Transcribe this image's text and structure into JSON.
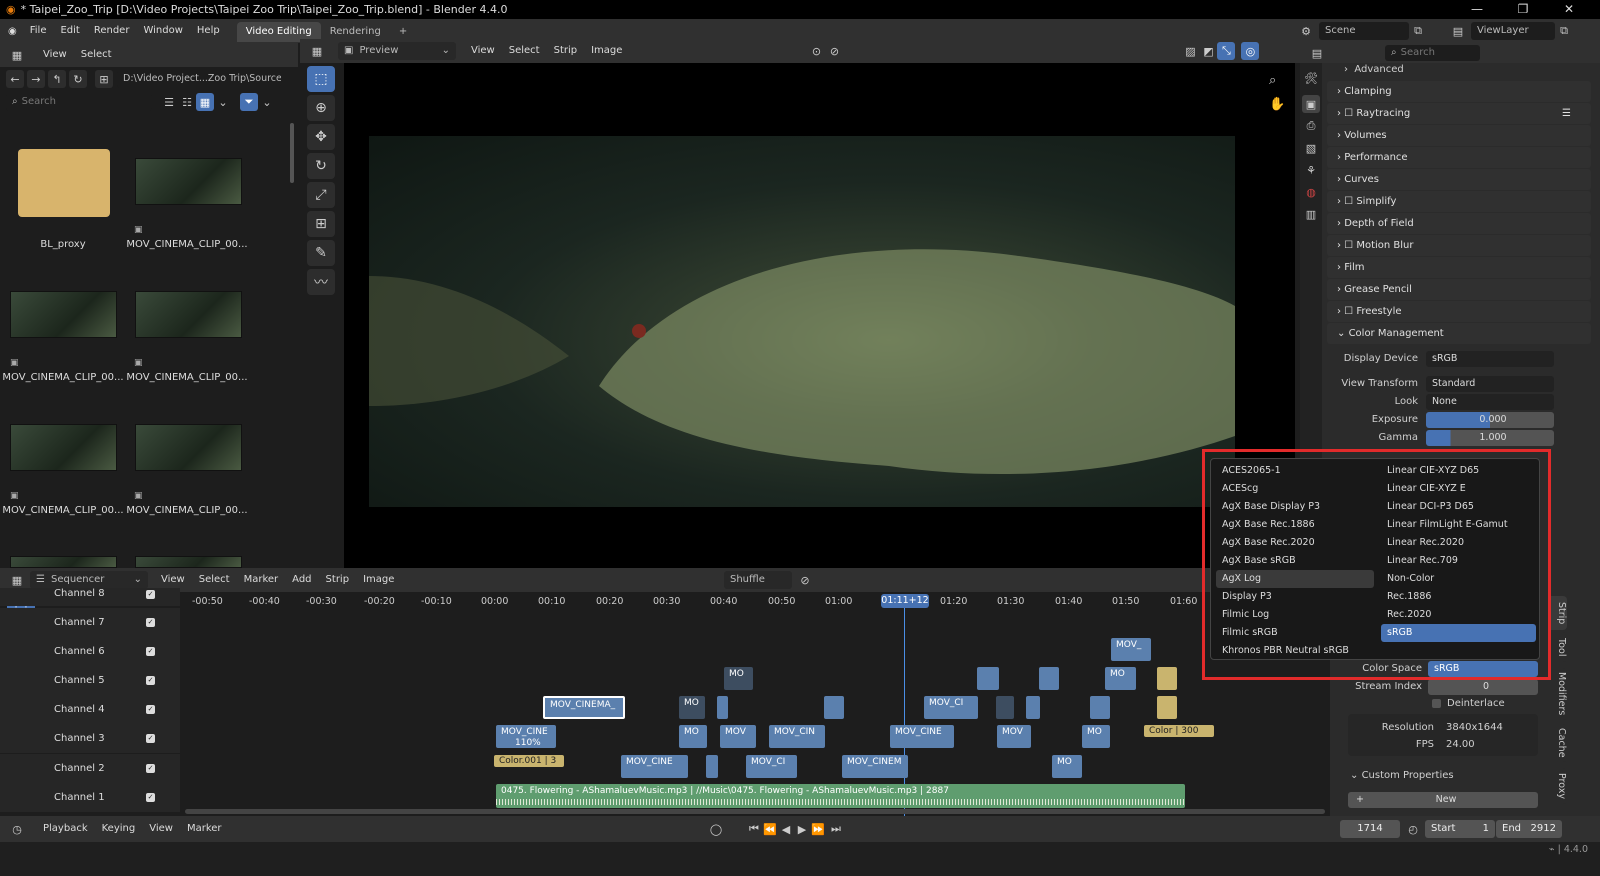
{
  "titlebar": {
    "title": "* Taipei_Zoo_Trip [D:\\Video Projects\\Taipei Zoo Trip\\Taipei_Zoo_Trip.blend] - Blender 4.4.0",
    "minimize": "—",
    "maximize": "❐",
    "close": "✕"
  },
  "topbar": {
    "menus": [
      "File",
      "Edit",
      "Render",
      "Window",
      "Help"
    ],
    "workspaces": [
      "Video Editing",
      "Rendering"
    ],
    "add_workspace": "+",
    "scene": "Scene",
    "viewlayer": "ViewLayer"
  },
  "filebrowser": {
    "menus": [
      "View",
      "Select"
    ],
    "path": "D:\\Video Project...Zoo Trip\\Source\\",
    "search_placeholder": "Search",
    "items": [
      "BL_proxy",
      "MOV_CINEMA_CLIP_00...",
      "MOV_CINEMA_CLIP_00...",
      "MOV_CINEMA_CLIP_00...",
      "MOV_CINEMA_CLIP_00...",
      "MOV_CINEMA_CLIP_00..."
    ]
  },
  "preview_header": {
    "mode": "Preview",
    "menus": [
      "View",
      "Select",
      "Strip",
      "Image"
    ]
  },
  "properties": {
    "search_placeholder": "Search",
    "panels": [
      "Advanced",
      "Clamping",
      "Raytracing",
      "Volumes",
      "Performance",
      "Curves",
      "Simplify",
      "Depth of Field",
      "Motion Blur",
      "Film",
      "Grease Pencil",
      "Freestyle",
      "Color Management"
    ],
    "display_device_label": "Display Device",
    "display_device": "sRGB",
    "view_transform_label": "View Transform",
    "view_transform": "Standard",
    "look_label": "Look",
    "look": "None",
    "exposure_label": "Exposure",
    "exposure": "0.000",
    "gamma_label": "Gamma",
    "gamma": "1.000",
    "color_space_label": "Color Space",
    "color_space": "sRGB",
    "stream_index_label": "Stream Index",
    "stream_index": "0",
    "deinterlace_label": "Deinterlace",
    "resolution_label": "Resolution",
    "resolution": "3840x1644",
    "fps_label": "FPS",
    "fps": "24.00",
    "custom_props": "Custom Properties",
    "new_button": "New",
    "side_tabs": [
      "Strip",
      "Tool",
      "Modifiers",
      "Cache",
      "Proxy"
    ]
  },
  "colorspace_menu": {
    "left": [
      "ACES2065-1",
      "ACEScg",
      "AgX Base Display P3",
      "AgX Base Rec.1886",
      "AgX Base Rec.2020",
      "AgX Base sRGB",
      "AgX Log",
      "Display P3",
      "Filmic Log",
      "Filmic sRGB",
      "Khronos PBR Neutral sRGB"
    ],
    "right": [
      "Linear CIE-XYZ D65",
      "Linear CIE-XYZ E",
      "Linear DCI-P3 D65",
      "Linear FilmLight E-Gamut",
      "Linear Rec.2020",
      "Linear Rec.709",
      "Non-Color",
      "Rec.1886",
      "Rec.2020",
      "sRGB"
    ],
    "hovered": "AgX Log",
    "selected": "sRGB"
  },
  "sequencer": {
    "mode": "Sequencer",
    "menus": [
      "View",
      "Select",
      "Marker",
      "Add",
      "Strip",
      "Image"
    ],
    "overlap": "Shuffle",
    "channels": [
      "Channel 8",
      "Channel 7",
      "Channel 6",
      "Channel 5",
      "Channel 4",
      "Channel 3",
      "Channel 2",
      "Channel 1"
    ],
    "ticks": [
      "-00:50",
      "-00:40",
      "-00:30",
      "-00:20",
      "-00:10",
      "00:00",
      "00:10",
      "00:20",
      "00:30",
      "00:40",
      "00:50",
      "01:00",
      "01:20",
      "01:30",
      "01:40",
      "01:50",
      "01:60"
    ],
    "playhead": "01:11+12",
    "strips": {
      "mov_cinema": "MOV_CINEMA_",
      "mov_cine": "MOV_CINE",
      "pct": "110%",
      "mo": "MO",
      "mov": "MOV",
      "mov_cin": "MOV_CIN",
      "mov_ci": "MOV_CI",
      "mov_cinem": "MOV_CINEM",
      "mov_u": "MOV_",
      "color001": "Color.001 | 3",
      "color300": "Color | 300",
      "audio": "0475. Flowering - AShamaluevMusic.mp3 | //Music\\0475. Flowering - AShamaluevMusic.mp3 | 2887"
    }
  },
  "statusbar": {
    "menus": [
      "Playback",
      "Keying",
      "View",
      "Marker"
    ],
    "frame": "1714",
    "start_label": "Start",
    "start": "1",
    "end_label": "End",
    "end": "2912",
    "version": "4.4.0"
  },
  "colors": {
    "accent": "#4772b3",
    "highlight_box": "#e22b2b",
    "strip_movie": "#5b80ae",
    "strip_color": "#c9b46e",
    "strip_audio": "#5f9d6f"
  }
}
